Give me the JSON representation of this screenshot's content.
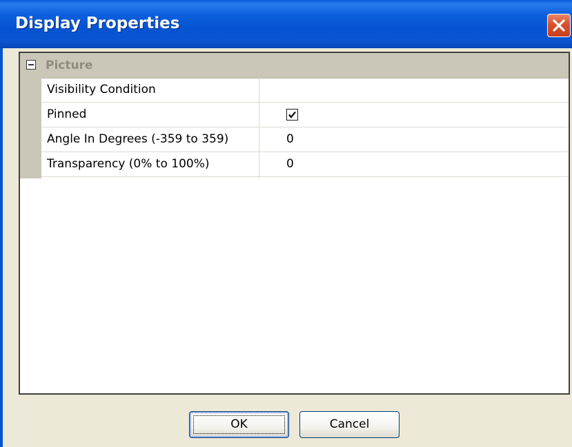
{
  "window": {
    "title": "Display Properties"
  },
  "grid": {
    "category": {
      "label": "Picture",
      "expanded": true
    },
    "properties": [
      {
        "name": "Visibility Condition",
        "value": ""
      },
      {
        "name": "Pinned",
        "checked": true
      },
      {
        "name": "Angle In Degrees (-359 to 359)",
        "value": "0"
      },
      {
        "name": "Transparency (0% to 100%)",
        "value": "0"
      }
    ]
  },
  "buttons": {
    "ok_label": "OK",
    "cancel_label": "Cancel"
  },
  "colors": {
    "titlebar": "#0553d2",
    "close_button": "#d9512c",
    "category_bar": "#cbc7b8",
    "dialog_background": "#ece9d8"
  }
}
